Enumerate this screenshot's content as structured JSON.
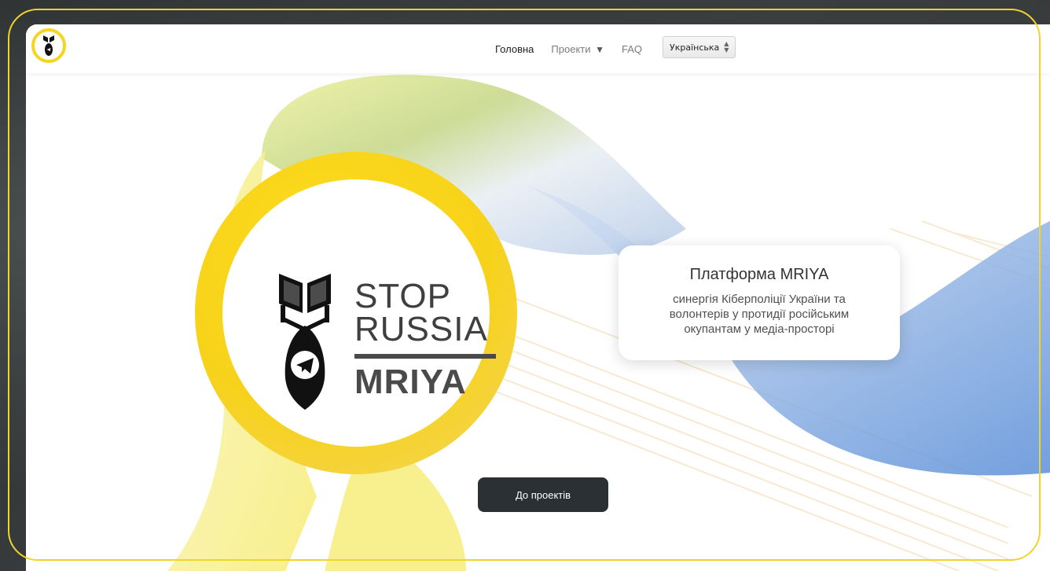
{
  "header": {
    "logo_icon": "bomb-telegram-logo-icon",
    "nav": {
      "home": "Головна",
      "projects": "Проекти",
      "projects_arrow": "▼",
      "faq": "FAQ"
    },
    "language": {
      "selected": "Українська"
    }
  },
  "hero": {
    "logo": {
      "line1": "STOP",
      "line2": "RUSSIA",
      "line3": "MRIYA",
      "icon": "bomb-with-telegram-icon"
    },
    "card": {
      "title": "Платформа MRIYA",
      "description": "синергія Кіберполіції України та волонтерів у протидії російським окупантам у медіа-просторі"
    },
    "cta_label": "До проектів"
  },
  "colors": {
    "accent_yellow": "#F5D51F",
    "accent_blue": "#5B8FD8",
    "button_dark": "#2B3034",
    "frame_yellow": "#F0D42A"
  }
}
